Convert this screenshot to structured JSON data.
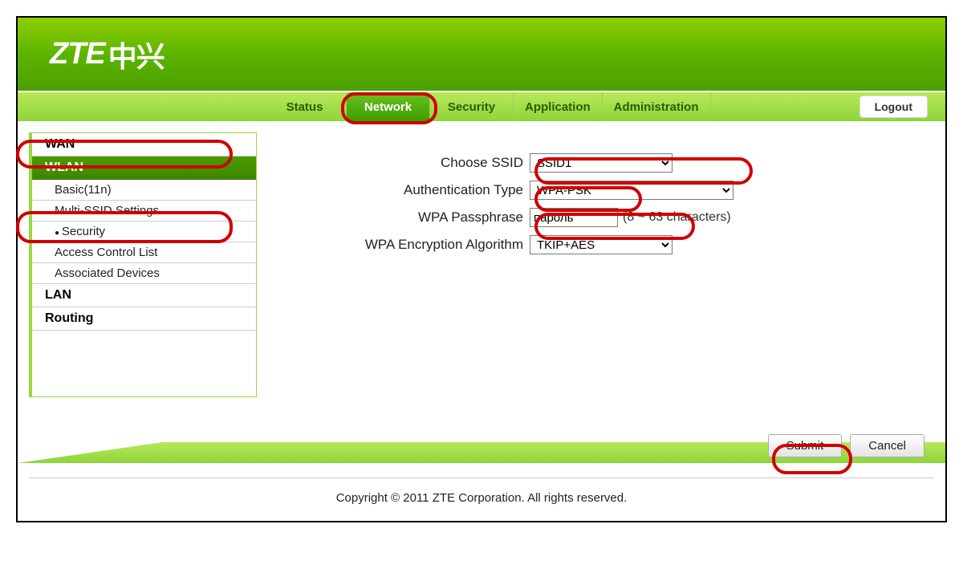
{
  "brand": {
    "name": "ZTE",
    "cn": "中兴"
  },
  "tabs": {
    "status": "Status",
    "network": "Network",
    "security": "Security",
    "application": "Application",
    "administration": "Administration"
  },
  "logout": "Logout",
  "sidebar": {
    "wan": "WAN",
    "wlan": "WLAN",
    "basic": "Basic(11n)",
    "multi": "Multi-SSID Settings",
    "security": "Security",
    "acl": "Access Control List",
    "assoc": "Associated Devices",
    "lan": "LAN",
    "routing": "Routing"
  },
  "form": {
    "labels": {
      "ssid": "Choose SSID",
      "auth": "Authentication Type",
      "pass": "WPA Passphrase",
      "enc": "WPA Encryption Algorithm"
    },
    "values": {
      "ssid": "SSID1",
      "auth": "WPA-PSK",
      "pass": "пароль",
      "enc": "TKIP+AES"
    },
    "hint": "(8 ~ 63 characters)"
  },
  "buttons": {
    "submit": "Submit",
    "cancel": "Cancel"
  },
  "footer": "Copyright © 2011 ZTE Corporation. All rights reserved."
}
